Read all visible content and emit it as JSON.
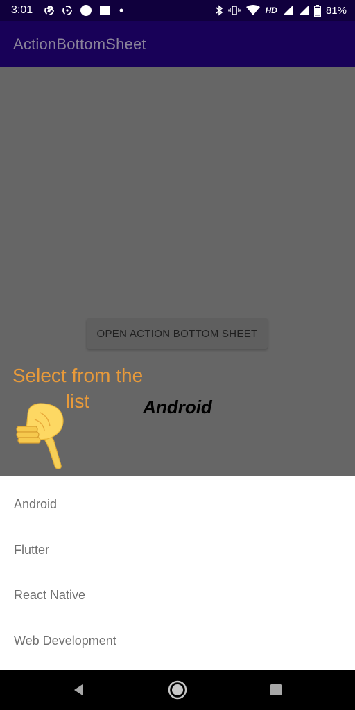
{
  "status_bar": {
    "time": "3:01",
    "network_label": "HD",
    "battery_percent": "81%",
    "icons": [
      "sync-icon",
      "sync-icon",
      "circle-icon",
      "square-icon",
      "dot-icon",
      "bluetooth-icon",
      "vibrate-icon",
      "wifi-icon",
      "signal-icon",
      "signal-icon",
      "battery-icon"
    ]
  },
  "app_bar": {
    "title": "ActionBottomSheet"
  },
  "main": {
    "open_button_label": "OPEN ACTION BOTTOM SHEET",
    "hint_line1": "Select from the",
    "hint_line2": "list",
    "hint_icon": "pointing-down-hand-icon",
    "selected_value": "Android"
  },
  "bottom_sheet": {
    "items": [
      {
        "label": "Android"
      },
      {
        "label": "Flutter"
      },
      {
        "label": "React Native"
      },
      {
        "label": "Web Development"
      }
    ]
  },
  "nav_bar": {
    "icons": [
      "back-icon",
      "home-icon",
      "recents-icon"
    ]
  },
  "colors": {
    "status_bar_bg": "#10003d",
    "app_bar_bg": "#180158",
    "scrim": "#666666",
    "hint_text": "#e89a3a",
    "sheet_bg": "#ffffff",
    "sheet_text": "#6f6f6f"
  }
}
